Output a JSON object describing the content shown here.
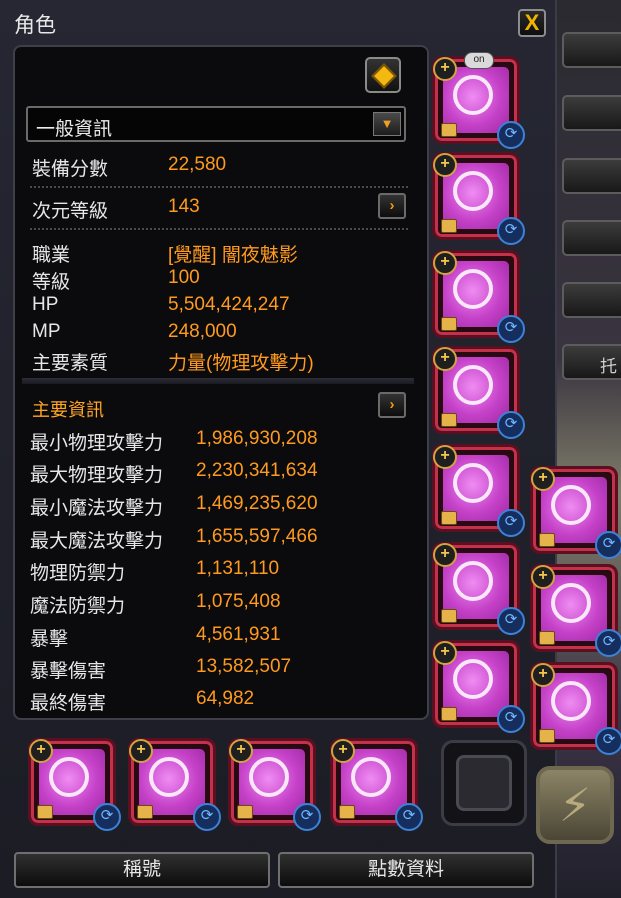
{
  "window": {
    "title": "角色",
    "close_label": "X"
  },
  "general": {
    "dropdown_value": "一般資訊",
    "rows_top": [
      {
        "label": "裝備分數",
        "value": "22,580"
      },
      {
        "label": "次元等級",
        "value": "143"
      }
    ],
    "rows_char": [
      {
        "label": "職業",
        "value": "[覺醒] 闇夜魅影"
      },
      {
        "label": "等級",
        "value": "100"
      },
      {
        "label": "HP",
        "value": "5,504,424,247"
      },
      {
        "label": "MP",
        "value": "248,000"
      },
      {
        "label": "主要素質",
        "value": "力量(物理攻擊力)"
      }
    ]
  },
  "main_info": {
    "title": "主要資訊",
    "rows": [
      {
        "label": "最小物理攻擊力",
        "value": "1,986,930,208"
      },
      {
        "label": "最大物理攻擊力",
        "value": "2,230,341,634"
      },
      {
        "label": "最小魔法攻擊力",
        "value": "1,469,235,620"
      },
      {
        "label": "最大魔法攻擊力",
        "value": "1,655,597,466"
      },
      {
        "label": "物理防禦力",
        "value": "1,131,110"
      },
      {
        "label": "魔法防禦力",
        "value": "1,075,408"
      },
      {
        "label": "暴擊",
        "value": "4,561,931"
      },
      {
        "label": "暴擊傷害",
        "value": "13,582,507"
      },
      {
        "label": "最終傷害",
        "value": "64,982"
      }
    ]
  },
  "equipment": {
    "badge_text": "on",
    "slot_color": "#c541c8",
    "icons": [
      "plus-icon",
      "chest-icon",
      "sync-icon"
    ]
  },
  "buttons": {
    "title_label": "稱號",
    "points_label": "點數資料"
  },
  "side_text": "托"
}
